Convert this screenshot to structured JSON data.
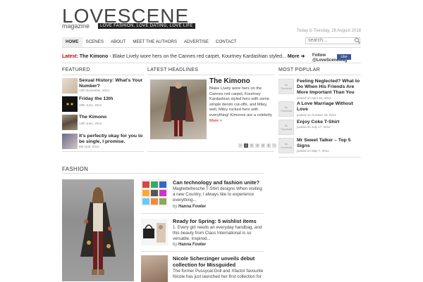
{
  "header": {
    "logo": "LOVESCENE",
    "logo_sub": "magazine",
    "tagline": "LOVE FASHION, LOVE DATING, LOVE LIFE",
    "date": "Today is Tuesday, 28 August 2018",
    "search_placeholder": "search..."
  },
  "nav": {
    "items": [
      "HOME",
      "SCENES",
      "ABOUT",
      "MEET THE AUTHORS",
      "ADVERTISE",
      "CONTACT"
    ]
  },
  "latest": {
    "label": "Latest:",
    "title": "The Kimono",
    "text": "- Blake Lively wore hers on the Cannes red carpet, Kourtney Kardashian styled...",
    "more": "More ➜",
    "follow": "Follow @LoveSceneMag",
    "fb_label": "Like"
  },
  "sections": {
    "featured": "FEATURED",
    "latest_headlines": "LATEST HEADLINES",
    "most_popular": "MOST POPULAR",
    "fashion": "FASHION"
  },
  "featured": [
    {
      "title": "Sexual History: What's Your Number?",
      "date": "12th November, 2014"
    },
    {
      "title": "Friday the 13th",
      "date": "19th June, 2014"
    },
    {
      "title": "The Kimono",
      "date": "13th June, 2014"
    },
    {
      "title": "It's perfectly okay for you to be single, I promise.",
      "date": "8th April, 2014"
    }
  ],
  "headline": {
    "title": "The Kimono",
    "text": "Blake Lively wore hers on the Cannes red carpet, Kourtney Kardashian styled hers with some simple denim cut-offs, and Miley, well, Miley rocked hers with everything! Kimonos are a celebrity",
    "more": "More >",
    "pages": [
      "‹",
      "1",
      "2",
      "3",
      "4",
      "5",
      "›"
    ]
  },
  "popular": [
    {
      "title": "Feeling Neglected? What to Do When His Friends Are More Important Than You",
      "date": "posted on April 26, 2013",
      "thumb": "No Thumbnail"
    },
    {
      "title": "A Love Marriage Without Love",
      "date": "posted on October 26, 2012",
      "thumb": "No Thumbnail"
    },
    {
      "title": "Enjoy Coke T-Shirt",
      "date": "posted on July 17, 2012",
      "thumb": "No Thumbnail"
    },
    {
      "title": "Mr Sweet Talker – Top 5 Signs",
      "date": "posted on May 7, 2011",
      "thumb": "No Thumbnail"
    }
  ],
  "fashion": [
    {
      "title": "Can technology and fashion unite?",
      "text": "Magliettefresche T-Shirt designs When visiting a new Country, I always like to experience everything...",
      "by": "by",
      "author": "Hanna Fowler"
    },
    {
      "title": "Ready for Spring: 5 wishlist items",
      "text": "1. Every girl needs an everyday handbag, and this beauty from Class International is so versatile. Inspired...",
      "by": "by",
      "author": "Hanna Fowler"
    },
    {
      "title": "Nicole Scherzinger unveils debut collection for Missguided",
      "text": "The former Pussycat Doll and Xfactor favourite Nicole has just launched her first collection for",
      "by": "",
      "author": ""
    }
  ]
}
